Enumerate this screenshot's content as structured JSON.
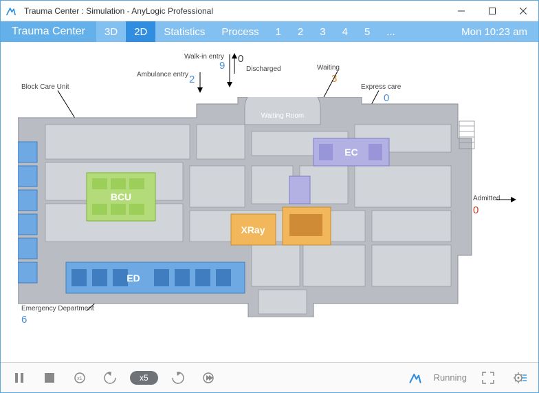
{
  "window": {
    "title": "Trauma Center : Simulation - AnyLogic Professional"
  },
  "tabs": {
    "main": "Trauma Center",
    "items": [
      "3D",
      "2D",
      "Statistics",
      "Process",
      "1",
      "2",
      "3",
      "4",
      "5",
      "..."
    ],
    "active_index": 1,
    "clock": "Mon 10:23 am"
  },
  "floorplan": {
    "labels": {
      "block_care_unit": "Block Care Unit",
      "ambulance_entry": "Ambulance entry",
      "walk_in_entry": "Walk-in entry",
      "discharged": "Discharged",
      "waiting": "Waiting",
      "waiting_room": "Waiting Room",
      "express_care": "Express care",
      "admitted": "Admitted",
      "emergency_department": "Emergency Department"
    },
    "zones": {
      "bcu": "BCU",
      "ed": "ED",
      "ec": "EC",
      "xray": "XRay"
    },
    "counts": {
      "ambulance_entry": "2",
      "walk_in_entry": "9",
      "discharged": "0",
      "waiting": "3",
      "express_care": "0",
      "admitted": "0",
      "emergency_department": "6"
    },
    "colors": {
      "blue": "#4a8dd6",
      "orange": "#e08b2c",
      "violet": "#8b89d6",
      "green": "#9cce5a",
      "grey": "#b9bdc3",
      "red": "#cc3a1e"
    }
  },
  "controls": {
    "speed_label": "x5",
    "status": "Running"
  }
}
